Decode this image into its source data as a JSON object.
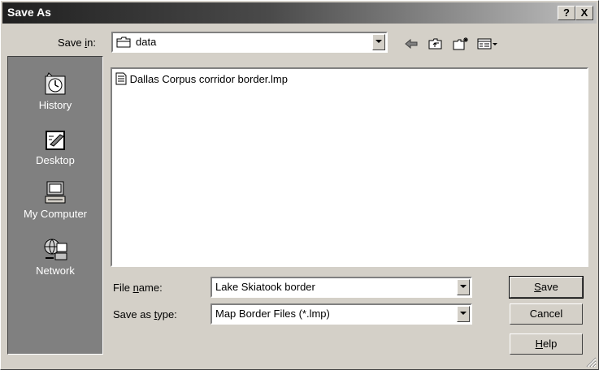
{
  "window": {
    "title": "Save As",
    "help_btn": "?",
    "close_btn": "X"
  },
  "save_in": {
    "label_prefix": "Save ",
    "label_accel": "i",
    "label_suffix": "n:",
    "value": "data"
  },
  "places": [
    {
      "label": "History",
      "icon": "history-icon"
    },
    {
      "label": "Desktop",
      "icon": "desktop-icon"
    },
    {
      "label": "My Computer",
      "icon": "my-computer-icon"
    },
    {
      "label": "Network",
      "icon": "network-icon"
    }
  ],
  "files": [
    {
      "name": "Dallas Corpus corridor border.lmp",
      "icon": "file-icon"
    }
  ],
  "file_name": {
    "label_prefix": "File ",
    "label_accel": "n",
    "label_suffix": "ame:",
    "value": "Lake Skiatook border"
  },
  "save_type": {
    "label_prefix": "Save as ",
    "label_accel": "t",
    "label_suffix": "ype:",
    "value": "Map Border Files (*.lmp)"
  },
  "buttons": {
    "save_accel": "S",
    "save_rest": "ave",
    "cancel": "Cancel",
    "help_accel": "H",
    "help_rest": "elp"
  }
}
